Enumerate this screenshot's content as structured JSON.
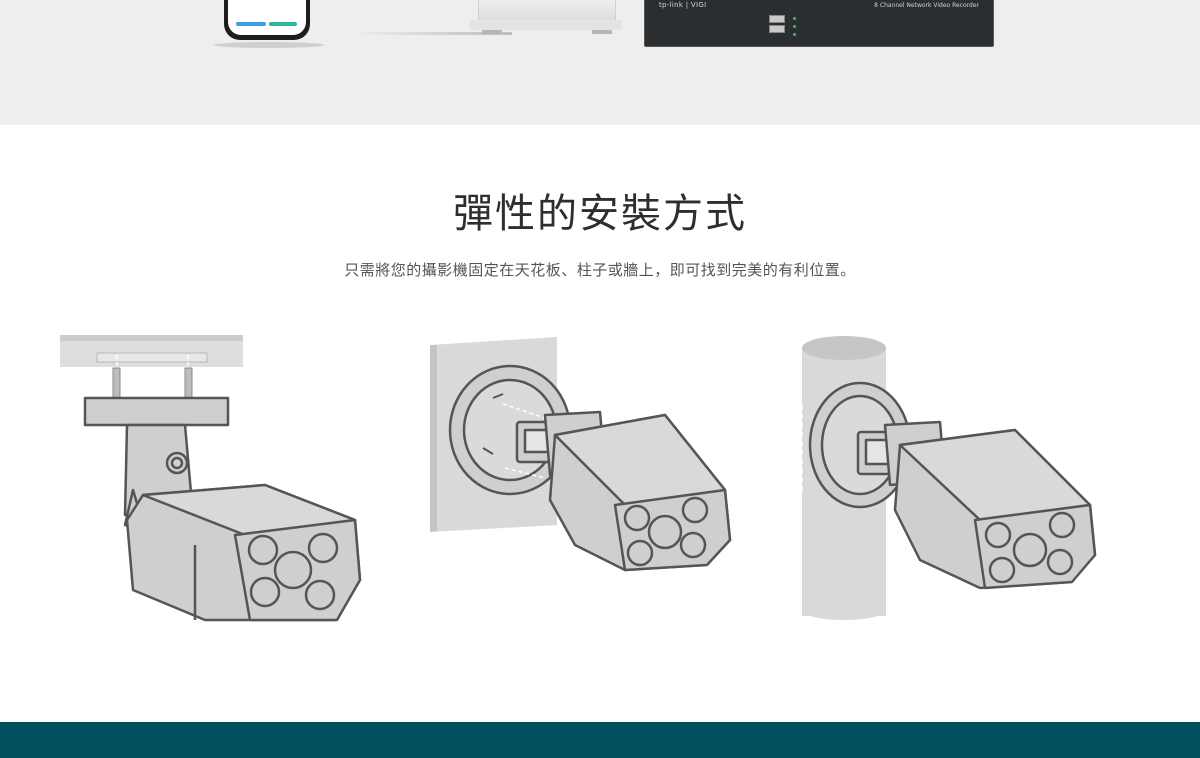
{
  "hero": {
    "nvr_logo": "tp-link | VIGI",
    "nvr_title": "8 Channel Network Video Recorder"
  },
  "section": {
    "title": "彈性的安裝方式",
    "subtitle": "只需將您的攝影機固定在天花板、柱子或牆上，即可找到完美的有利位置。"
  },
  "mounts": [
    {
      "id": "ceiling",
      "icon": "ceiling-mount-camera-illustration"
    },
    {
      "id": "wall",
      "icon": "wall-mount-camera-illustration"
    },
    {
      "id": "pole",
      "icon": "pole-mount-camera-illustration"
    }
  ],
  "colors": {
    "hero_bg": "#eeeeee",
    "camera_fill": "#cfcfcf",
    "camera_stroke": "#555555",
    "footer_band": "#01505f"
  }
}
